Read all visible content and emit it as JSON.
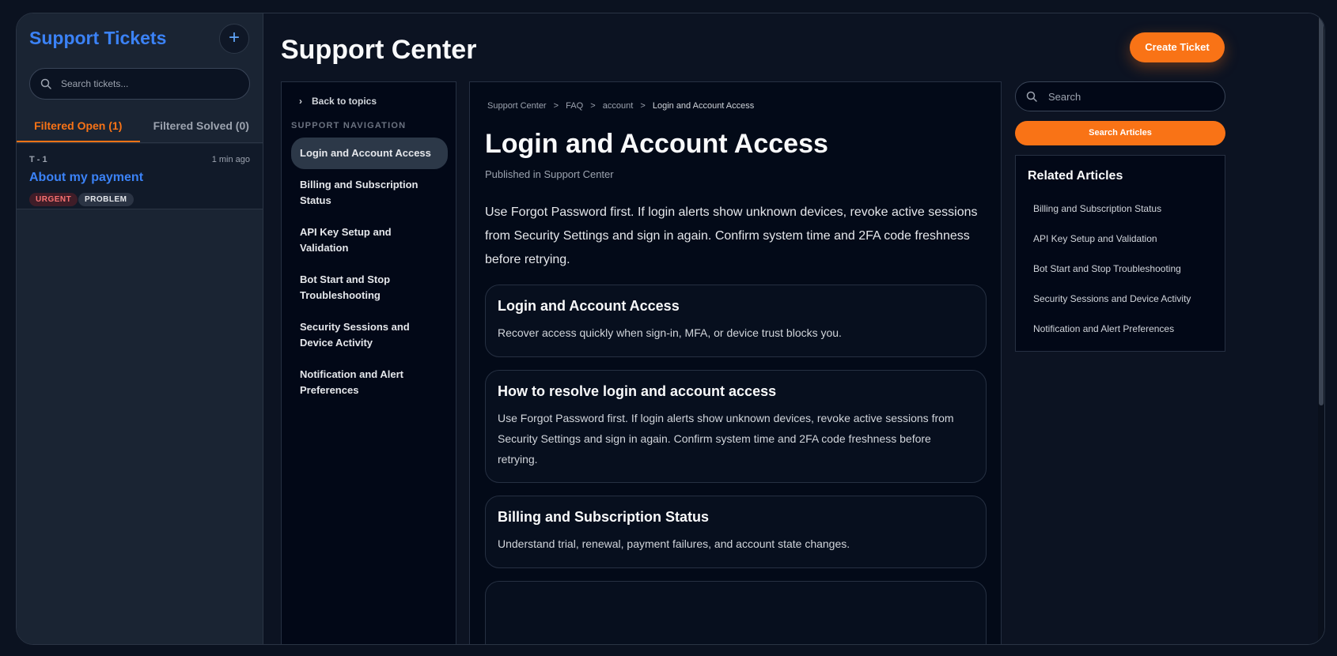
{
  "sidebar": {
    "title": "Support Tickets",
    "add_icon": "plus-icon",
    "search_placeholder": "Search tickets...",
    "tabs": [
      {
        "label": "Filtered Open (1)",
        "active": true
      },
      {
        "label": "Filtered Solved (0)",
        "active": false
      }
    ],
    "tickets": [
      {
        "id": "T - 1",
        "time": "1 min ago",
        "subject": "About my payment",
        "priority": "URGENT",
        "type": "PROBLEM"
      }
    ]
  },
  "header": {
    "title": "Support Center",
    "create_label": "Create Ticket"
  },
  "nav": {
    "back_label": "Back to topics",
    "heading": "SUPPORT NAVIGATION",
    "items": [
      "Login and Account Access",
      "Billing and Subscription Status",
      "API Key Setup and Validation",
      "Bot Start and Stop Troubleshooting",
      "Security Sessions and Device Activity",
      "Notification and Alert Preferences"
    ],
    "active_index": 0
  },
  "article": {
    "breadcrumb": [
      "Support Center",
      ">",
      "FAQ",
      ">",
      "account",
      ">",
      "Login and Account Access"
    ],
    "title": "Login and Account Access",
    "meta": "Published in Support Center",
    "body": "Use Forgot Password first. If login alerts show unknown devices, revoke active sessions from Security Settings and sign in again. Confirm system time and 2FA code freshness before retrying.",
    "cards": [
      {
        "title": "Login and Account Access",
        "text": "Recover access quickly when sign-in, MFA, or device trust blocks you."
      },
      {
        "title": "How to resolve login and account access",
        "text": "Use Forgot Password first. If login alerts show unknown devices, revoke active sessions from Security Settings and sign in again. Confirm system time and 2FA code freshness before retrying."
      },
      {
        "title": "Billing and Subscription Status",
        "text": "Understand trial, renewal, payment failures, and account state changes."
      },
      {
        "title": "",
        "text": ""
      }
    ]
  },
  "right": {
    "search_placeholder": "Search",
    "search_button": "Search Articles",
    "related_title": "Related Articles",
    "related": [
      "Billing and Subscription Status",
      "API Key Setup and Validation",
      "Bot Start and Stop Troubleshooting",
      "Security Sessions and Device Activity",
      "Notification and Alert Preferences"
    ]
  },
  "colors": {
    "accent": "#f97316",
    "link": "#3b82f6",
    "background": "#0c1322"
  }
}
